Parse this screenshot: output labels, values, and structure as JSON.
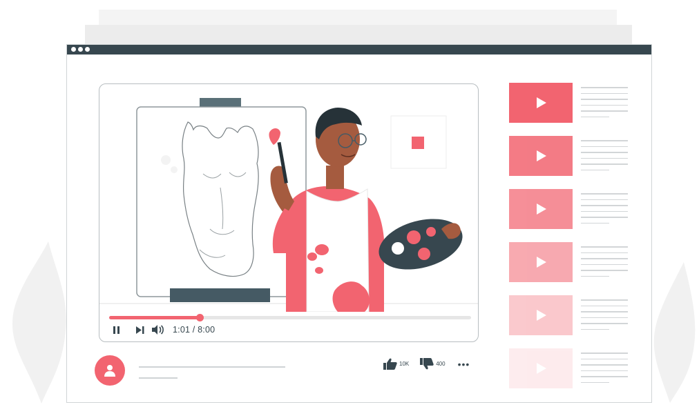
{
  "player": {
    "time_label": "1:01 / 8:00",
    "progress": 0.25
  },
  "actions": {
    "like_count": "10K",
    "dislike_count": "400",
    "more_label": "•••"
  },
  "recommendations": [
    {
      "thumb_color": "#f26470",
      "opacity": 1.0
    },
    {
      "thumb_color": "#f26470",
      "opacity": 0.85
    },
    {
      "thumb_color": "#f26470",
      "opacity": 0.72
    },
    {
      "thumb_color": "#f26470",
      "opacity": 0.55
    },
    {
      "thumb_color": "#f26470",
      "opacity": 0.35
    },
    {
      "thumb_color": "#f26470",
      "opacity": 0.12
    }
  ],
  "colors": {
    "accent": "#f26470",
    "dark": "#37474f"
  },
  "icons": [
    "pause-icon",
    "skip-next-icon",
    "volume-icon",
    "user-icon",
    "thumbs-up-icon",
    "thumbs-down-icon",
    "play-icon"
  ]
}
